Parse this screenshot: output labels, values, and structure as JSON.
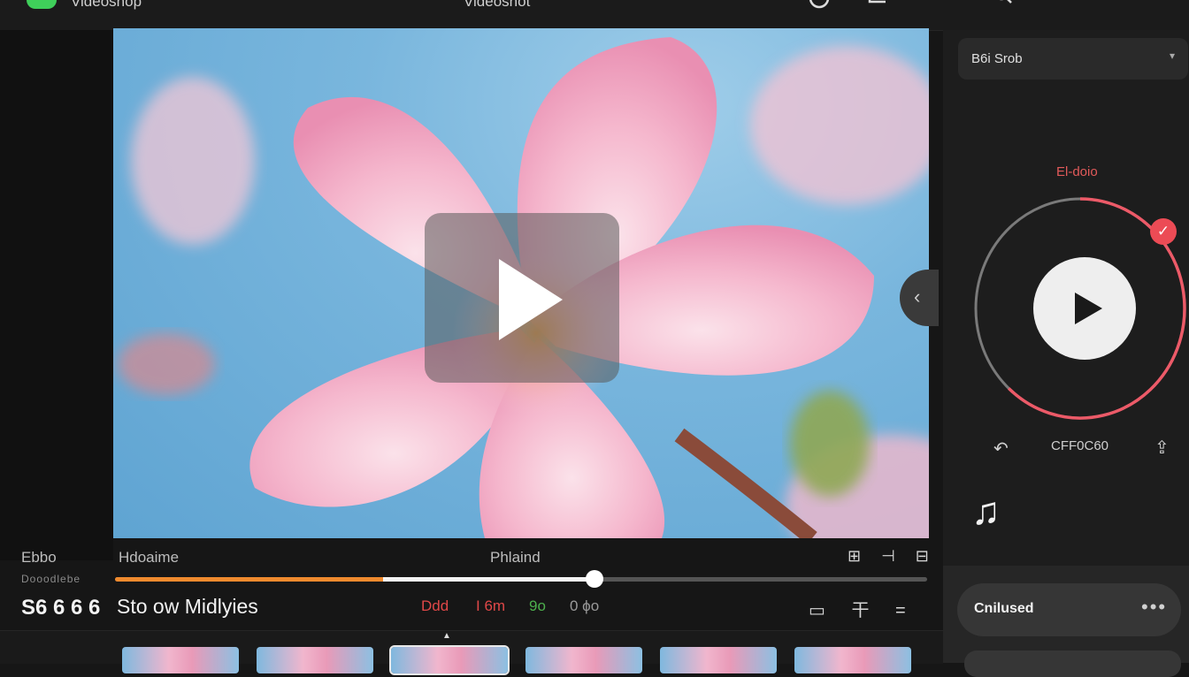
{
  "app": {
    "name": "Videoshop",
    "doc_title": "Videoshot"
  },
  "timeline": {
    "label_left_top": "Ebbo",
    "label_left_mid": "Dooodlebe",
    "label_left_big": "S6 6 6 6",
    "label_title_a": "Hdoaime",
    "label_title_b": "Phlaind",
    "track_name": "Sto ow Midlyies",
    "tools_icons": "⊞ ⊣ ⊟",
    "progress": 0.59,
    "buffered_from": 0.33,
    "timecodes": [
      {
        "text": "Ddd",
        "color": "#e04848"
      },
      {
        "text": "I 6m",
        "color": "#e04848"
      },
      {
        "text": "9o",
        "color": "#4db04d"
      },
      {
        "text": "0 ϕo",
        "color": "#9a9a9a"
      }
    ],
    "bar_icons": "▭ 干 = ",
    "frames_count": 6,
    "selected_frame": 2
  },
  "right_panel": {
    "dropdown_label": "B6i Srob",
    "mode_label": "El-doio",
    "ring_progress": 0.62,
    "controls_mid": "CFF0C60",
    "chip_label": "Cnilused",
    "chip_more": "•••"
  },
  "colors": {
    "accent_orange": "#f08a2e",
    "accent_red": "#ec4b55",
    "accent_green": "#3fcf5a"
  },
  "icons": [
    "logo-icon",
    "timer-icon",
    "chat-icon",
    "plus-icon",
    "search-icon",
    "grid-icon",
    "menu-icon",
    "play-icon",
    "chevron-left-icon",
    "check-icon",
    "undo-icon",
    "share-icon",
    "music-note-icon",
    "more-icon"
  ]
}
